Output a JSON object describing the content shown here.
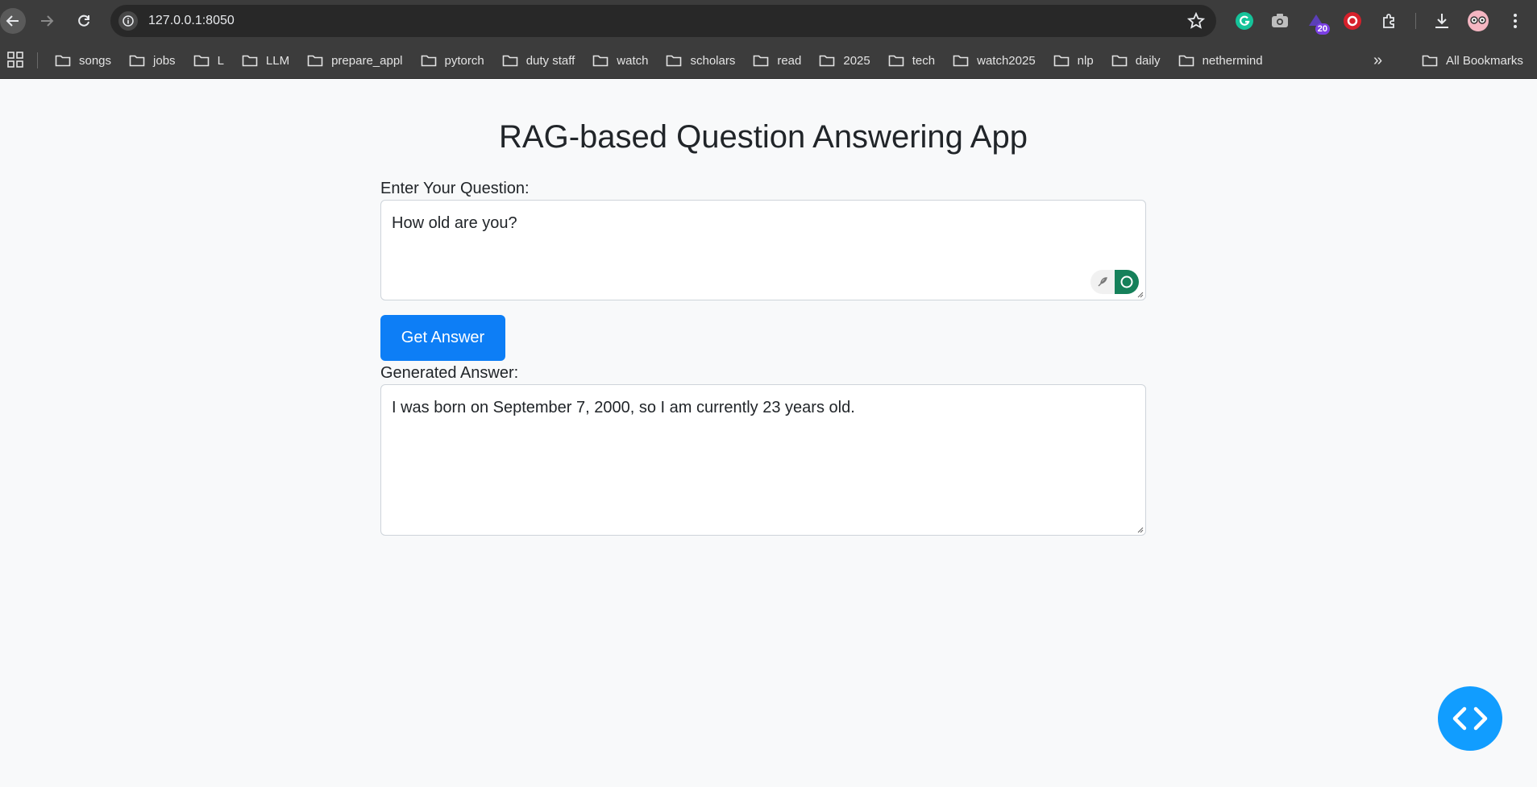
{
  "browser": {
    "url": "127.0.0.1:8050",
    "extension_badge": "20",
    "bookmarks": [
      "songs",
      "jobs",
      "L",
      "LLM",
      "prepare_appl",
      "pytorch",
      "duty staff",
      "watch",
      "scholars",
      "read",
      "2025",
      "tech",
      "watch2025",
      "nlp",
      "daily",
      "nethermind"
    ],
    "more_bookmarks": "»",
    "all_bookmarks": "All Bookmarks"
  },
  "app": {
    "title": "RAG-based Question Answering App",
    "question_label": "Enter Your Question:",
    "question_value": "How old are you?",
    "submit_label": "Get Answer",
    "answer_label": "Generated Answer:",
    "answer_value": "I was born on September 7, 2000, so I am currently 23 years old."
  },
  "colors": {
    "primary_button": "#0d7ef6",
    "fab": "#119dff",
    "grammarly": "#15805a"
  },
  "icons": [
    "back-arrow-icon",
    "forward-arrow-icon",
    "reload-icon",
    "site-info-icon",
    "bookmark-star-icon",
    "grammarly-icon",
    "camera-icon",
    "extension-icon",
    "extensions-puzzle-icon",
    "download-icon",
    "profile-avatar-icon",
    "menu-kebab-icon",
    "apps-grid-icon",
    "folder-icon",
    "code-icon"
  ]
}
